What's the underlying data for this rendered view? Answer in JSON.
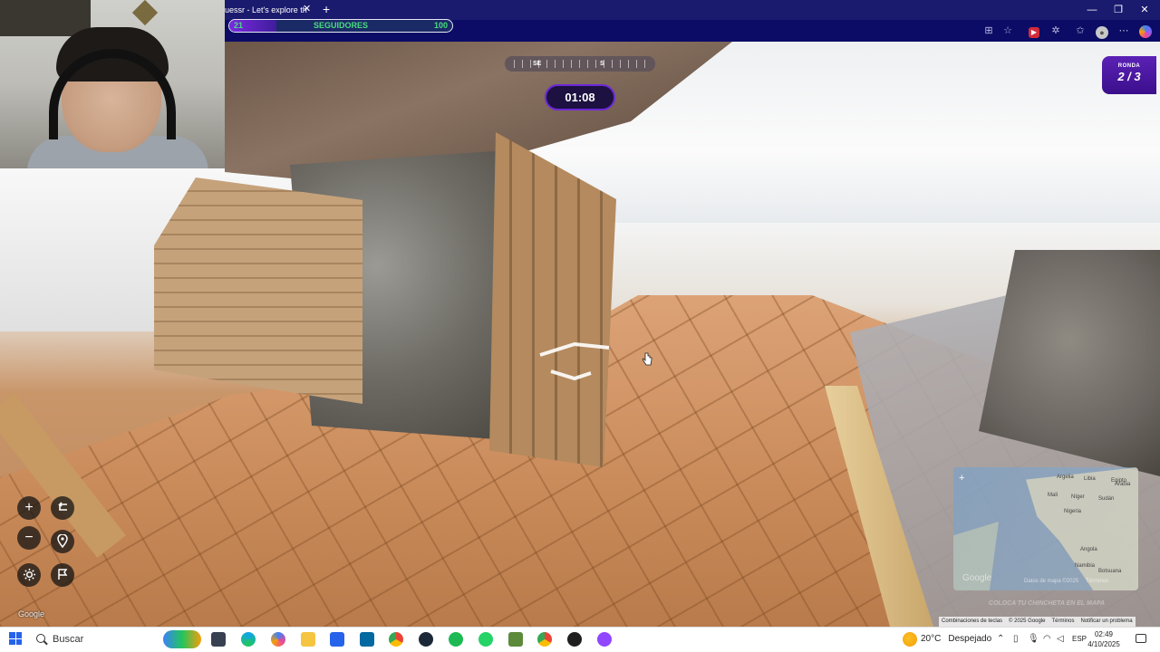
{
  "browser": {
    "tab_title": "uessr - Let's explore th",
    "new_tab_glyph": "+",
    "close_glyph": "✕",
    "window_controls": {
      "minimize": "—",
      "restore": "❐",
      "close": "✕"
    },
    "toolbar_icons": [
      "read-aloud-icon",
      "favorite-star-icon",
      "extension-red-icon",
      "extensions-icon",
      "favorites-icon",
      "profile-avatar-icon",
      "more-menu-icon",
      "copilot-icon"
    ]
  },
  "followers_bar": {
    "label": "SEGUIDORES",
    "current": "21",
    "max": "100",
    "fill_fraction": 0.21,
    "fill_color": "#7a2be0"
  },
  "compass": {
    "directions": [
      "SE",
      "S"
    ]
  },
  "timer": {
    "value": "01:08",
    "border_color": "#6d28d9"
  },
  "round": {
    "label": "RONDA",
    "value": "2 / 3"
  },
  "map_controls": {
    "zoom_in": "+",
    "zoom_out": "−",
    "undo_icon": "undo-arrow-icon",
    "return_icon": "return-to-start-pin-icon",
    "settings_icon": "gear-icon",
    "flag_icon": "flag-icon"
  },
  "streetview": {
    "google_mark": "Google"
  },
  "minimap": {
    "zoom_in": "+",
    "labels": [
      "Argelia",
      "Libia",
      "Egipto",
      "Mali",
      "Níger",
      "Sudán",
      "Nigeria",
      "Arabia",
      "Angola",
      "Namibia",
      "Botsuana"
    ],
    "google_mark": "Google",
    "inner_attribution": [
      "Datos de mapa ©2025",
      "Términos"
    ],
    "place_button": "COLOCA TU CHINCHETA EN EL MAPA"
  },
  "attribution": {
    "shortcuts": "Combinaciones de teclas",
    "copyright": "© 2025 Google",
    "terms": "Términos",
    "report": "Notificar un problema"
  },
  "taskbar": {
    "search_placeholder": "Buscar",
    "apps": [
      "task-view-icon",
      "edge-icon",
      "copilot-app-icon",
      "file-explorer-icon",
      "store-icon",
      "outlook-icon",
      "chrome-icon",
      "steam-icon",
      "spotify-icon",
      "whatsapp-icon",
      "minecraft-icon",
      "chrome-alt-icon",
      "discord-icon",
      "twitch-studio-icon"
    ],
    "weather_temp": "20°C",
    "weather_desc": "Despejado",
    "language": "ESP",
    "time": "02:49",
    "date": "4/10/2025"
  }
}
